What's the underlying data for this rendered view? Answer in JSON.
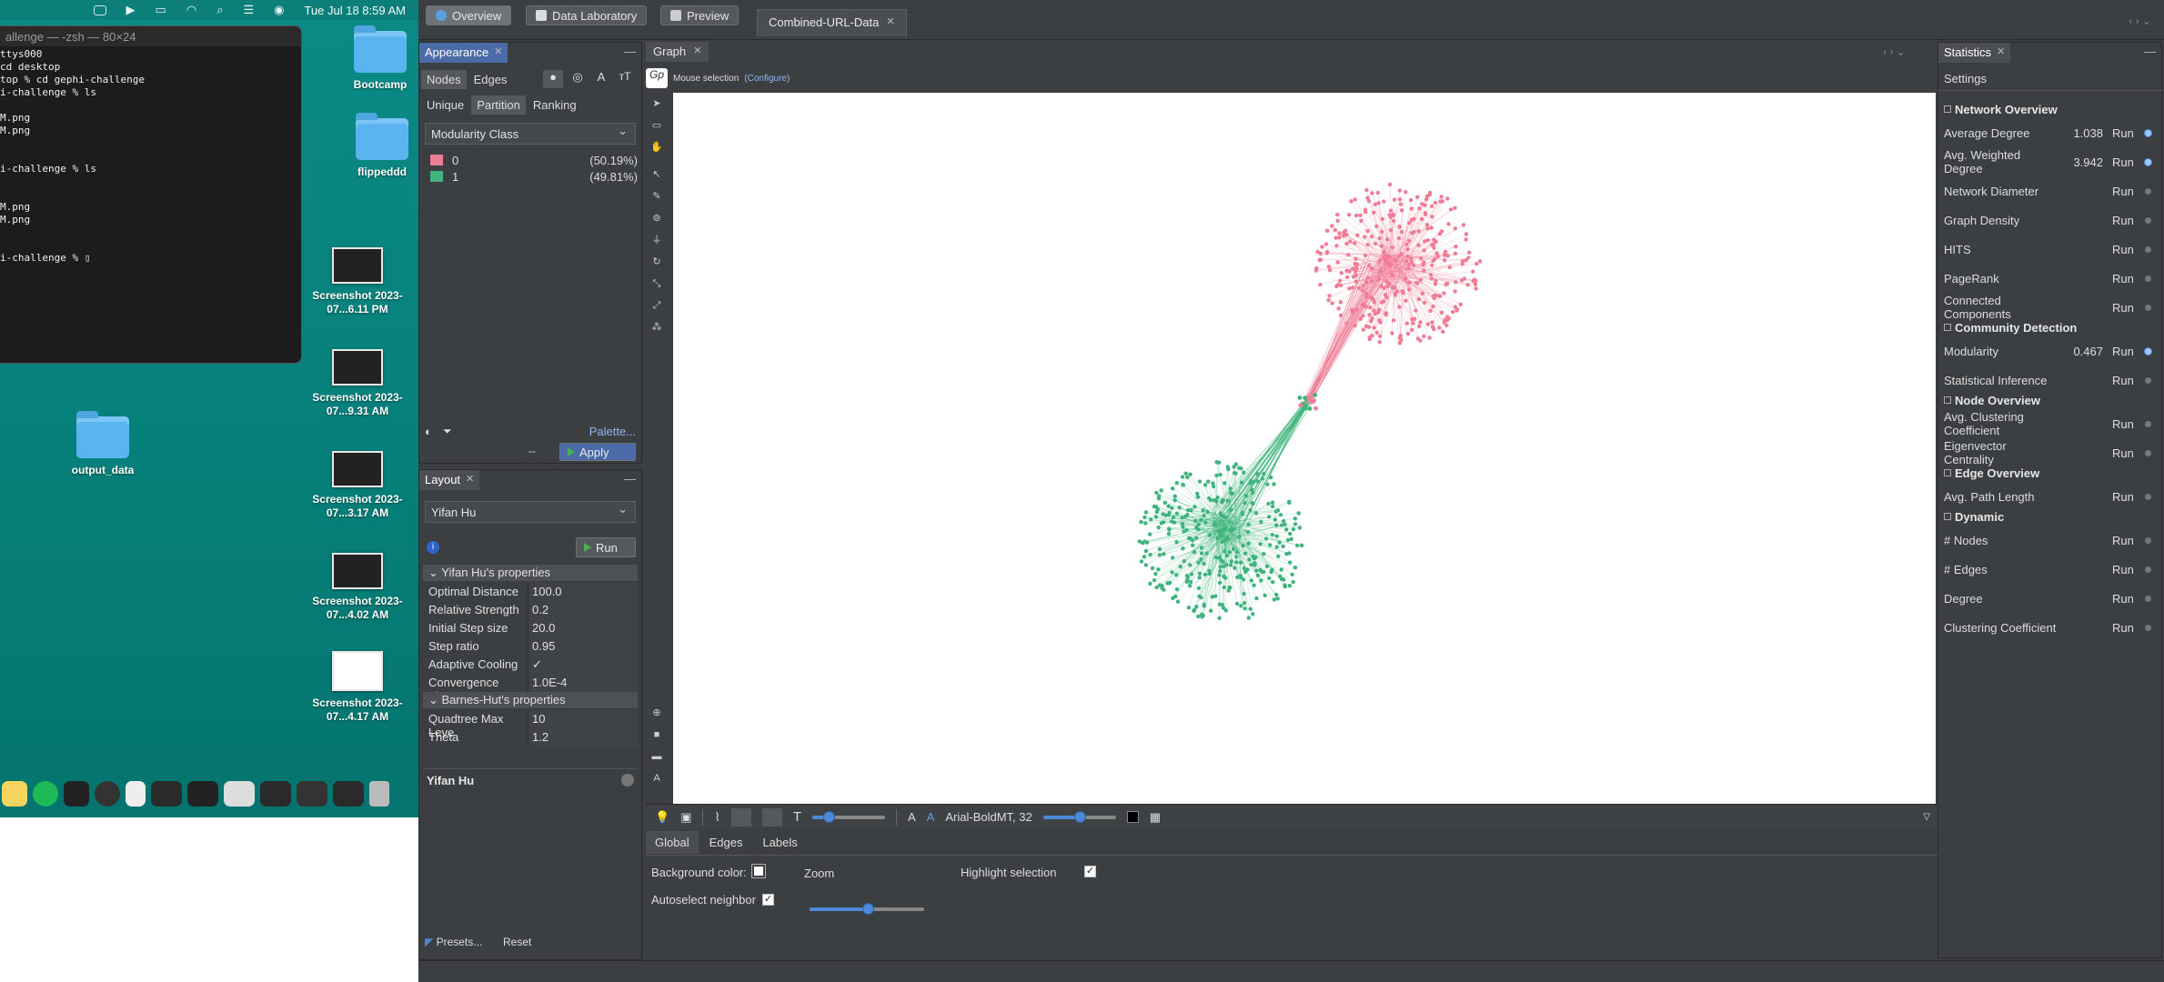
{
  "menubar": {
    "clock": "Tue Jul 18  8:59 AM"
  },
  "terminal": {
    "title": "allenge — -zsh — 80×24",
    "lines": [
      "ttys000",
      "cd desktop",
      "top % cd gephi-challenge",
      "i-challenge % ls",
      "",
      "M.png",
      "M.png",
      "",
      "",
      "i-challenge % ls",
      "",
      "",
      "M.png",
      "M.png",
      "",
      "",
      "i-challenge % ▯"
    ]
  },
  "desktop_icons": [
    {
      "label": "Bootcamp"
    },
    {
      "label": "flippeddd"
    },
    {
      "label": "output_data"
    },
    {
      "label": "Screenshot 2023-07...6.11 PM"
    },
    {
      "label": "Screenshot 2023-07...9.31 AM"
    },
    {
      "label": "Screenshot 2023-07...3.17 AM"
    },
    {
      "label": "Screenshot 2023-07...4.02 AM"
    },
    {
      "label": "Screenshot 2023-07...4.17 AM"
    }
  ],
  "topbar": {
    "overview": "Overview",
    "data_lab": "Data Laboratory",
    "preview": "Preview",
    "project": "Combined-URL-Data"
  },
  "appearance": {
    "tab": "Appearance",
    "nodes": "Nodes",
    "edges": "Edges",
    "unique": "Unique",
    "partition": "Partition",
    "ranking": "Ranking",
    "attribute": "Modularity Class",
    "partitions": [
      {
        "label": "0",
        "pct": "(50.19%)",
        "color": "#f07c95"
      },
      {
        "label": "1",
        "pct": "(49.81%)",
        "color": "#3fb47c"
      }
    ],
    "palette": "Palette...",
    "apply": "Apply",
    "dash": "--"
  },
  "layout": {
    "tab": "Layout",
    "algo": "Yifan Hu",
    "run": "Run",
    "section1": "Yifan Hu's properties",
    "props": [
      {
        "k": "Optimal Distance",
        "v": "100.0"
      },
      {
        "k": "Relative Strength",
        "v": "0.2"
      },
      {
        "k": "Initial Step size",
        "v": "20.0"
      },
      {
        "k": "Step ratio",
        "v": "0.95"
      },
      {
        "k": "Adaptive Cooling",
        "v": "✓"
      },
      {
        "k": "Convergence Thres",
        "v": "1.0E-4"
      }
    ],
    "section2": "Barnes-Hut's properties",
    "props2": [
      {
        "k": "Quadtree Max Leve",
        "v": "10"
      },
      {
        "k": "Theta",
        "v": "1.2"
      }
    ],
    "desc_title": "Yifan Hu",
    "presets": "Presets...",
    "reset": "Reset"
  },
  "graph": {
    "tab": "Graph",
    "mouse": "Mouse selection",
    "configure": "(Configure)",
    "font": "Arial-BoldMT, 32"
  },
  "graph_props": {
    "global": "Global",
    "edges": "Edges",
    "labels": "Labels",
    "bg_color": "Background color:",
    "zoom": "Zoom",
    "highlight": "Highlight selection",
    "autoselect": "Autoselect neighbor"
  },
  "statistics": {
    "tab": "Statistics",
    "settings": "Settings",
    "sections": [
      {
        "title": "Network Overview",
        "items": [
          {
            "name": "Average Degree",
            "val": "1.038",
            "active": true
          },
          {
            "name": "Avg. Weighted Degree",
            "val": "3.942",
            "active": true
          },
          {
            "name": "Network Diameter",
            "val": ""
          },
          {
            "name": "Graph Density",
            "val": ""
          },
          {
            "name": "HITS",
            "val": ""
          },
          {
            "name": "PageRank",
            "val": ""
          },
          {
            "name": "Connected Components",
            "val": ""
          }
        ]
      },
      {
        "title": "Community Detection",
        "items": [
          {
            "name": "Modularity",
            "val": "0.467",
            "active": true
          },
          {
            "name": "Statistical Inference",
            "val": ""
          }
        ]
      },
      {
        "title": "Node Overview",
        "items": [
          {
            "name": "Avg. Clustering Coefficient",
            "val": ""
          },
          {
            "name": "Eigenvector Centrality",
            "val": ""
          }
        ]
      },
      {
        "title": "Edge Overview",
        "items": [
          {
            "name": "Avg. Path Length",
            "val": ""
          }
        ]
      },
      {
        "title": "Dynamic",
        "items": [
          {
            "name": "# Nodes",
            "val": ""
          },
          {
            "name": "# Edges",
            "val": ""
          },
          {
            "name": "Degree",
            "val": ""
          },
          {
            "name": "Clustering Coefficient",
            "val": ""
          }
        ]
      }
    ],
    "run": "Run"
  },
  "colors": {
    "pink": "#f07c95",
    "green": "#3fb47c",
    "accent": "#4a6aa8"
  }
}
